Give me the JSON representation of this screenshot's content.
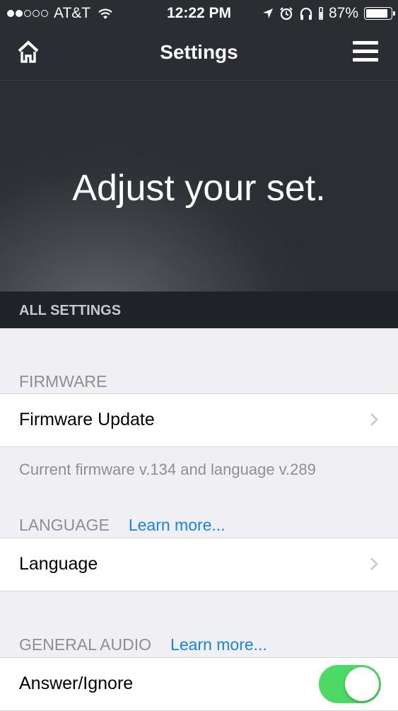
{
  "status_bar": {
    "carrier": "AT&T",
    "time": "12:22 PM",
    "battery": "87%",
    "battery_level": 0.87,
    "signal_bars_filled": 2,
    "signal_bars_total": 5
  },
  "nav": {
    "title": "Settings",
    "home_icon": "home-icon",
    "menu_icon": "hamburger-menu-icon"
  },
  "hero": {
    "text": "Adjust your set."
  },
  "all_settings_label": "ALL SETTINGS",
  "firmware": {
    "header": "FIRMWARE",
    "cell_label": "Firmware Update",
    "footnote": "Current firmware v.134 and language v.289"
  },
  "language": {
    "header": "LANGUAGE",
    "learn_more": "Learn more...",
    "cell_label": "Language"
  },
  "general_audio": {
    "header": "GENERAL AUDIO",
    "learn_more": "Learn more...",
    "cell_label": "Answer/Ignore",
    "toggle_on": true
  },
  "colors": {
    "accent": "#1a82e8",
    "toggle_on": "#4cd964",
    "nav_bg": "#2a2d31"
  }
}
